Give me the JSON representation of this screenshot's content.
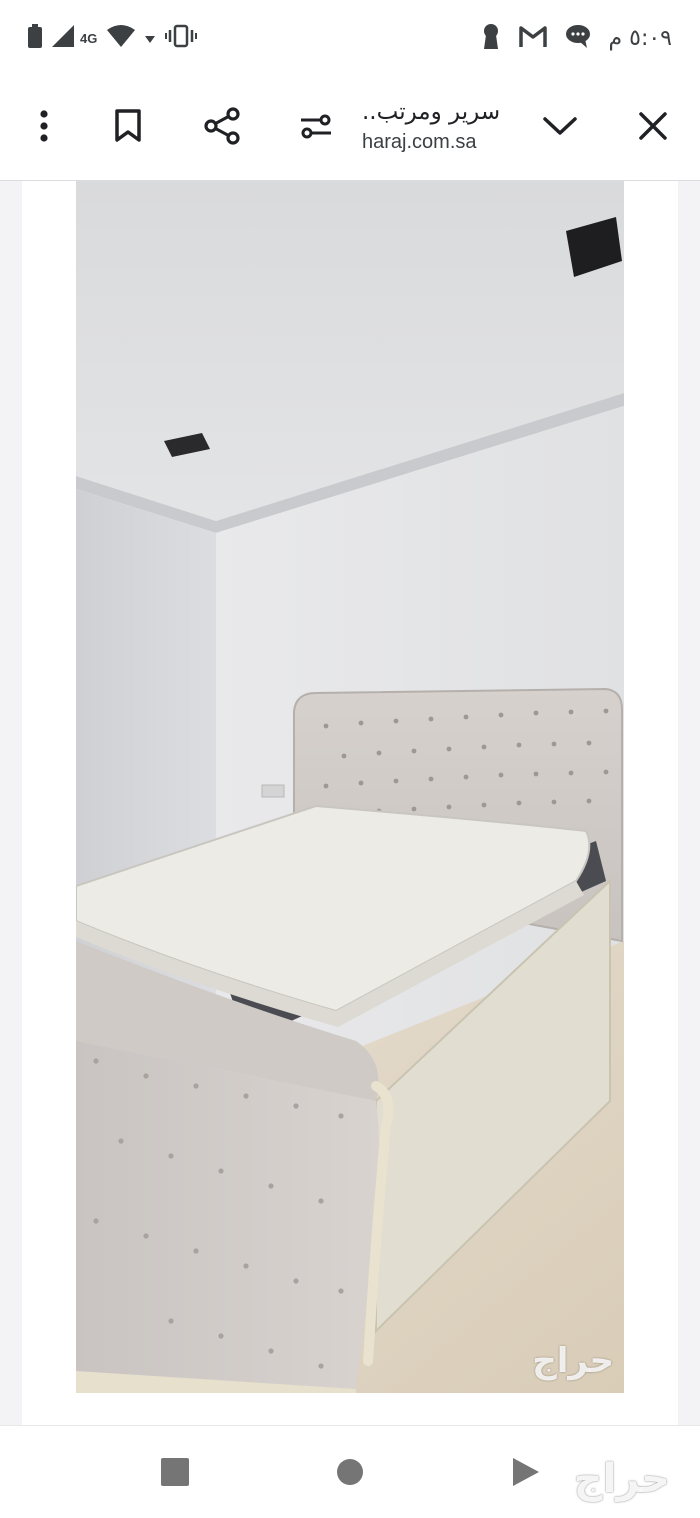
{
  "status_bar": {
    "time": "٥:٠٩ م",
    "network": "4G"
  },
  "toolbar": {
    "title": "سرير ومرتب..",
    "url": "haraj.com.sa"
  },
  "photo": {
    "watermark": "حراج"
  },
  "nav_bar": {
    "watermark": "حراج"
  },
  "colors": {
    "icon": "#202124",
    "nav_icon": "#757575",
    "page_bg": "#f3f3f5"
  }
}
